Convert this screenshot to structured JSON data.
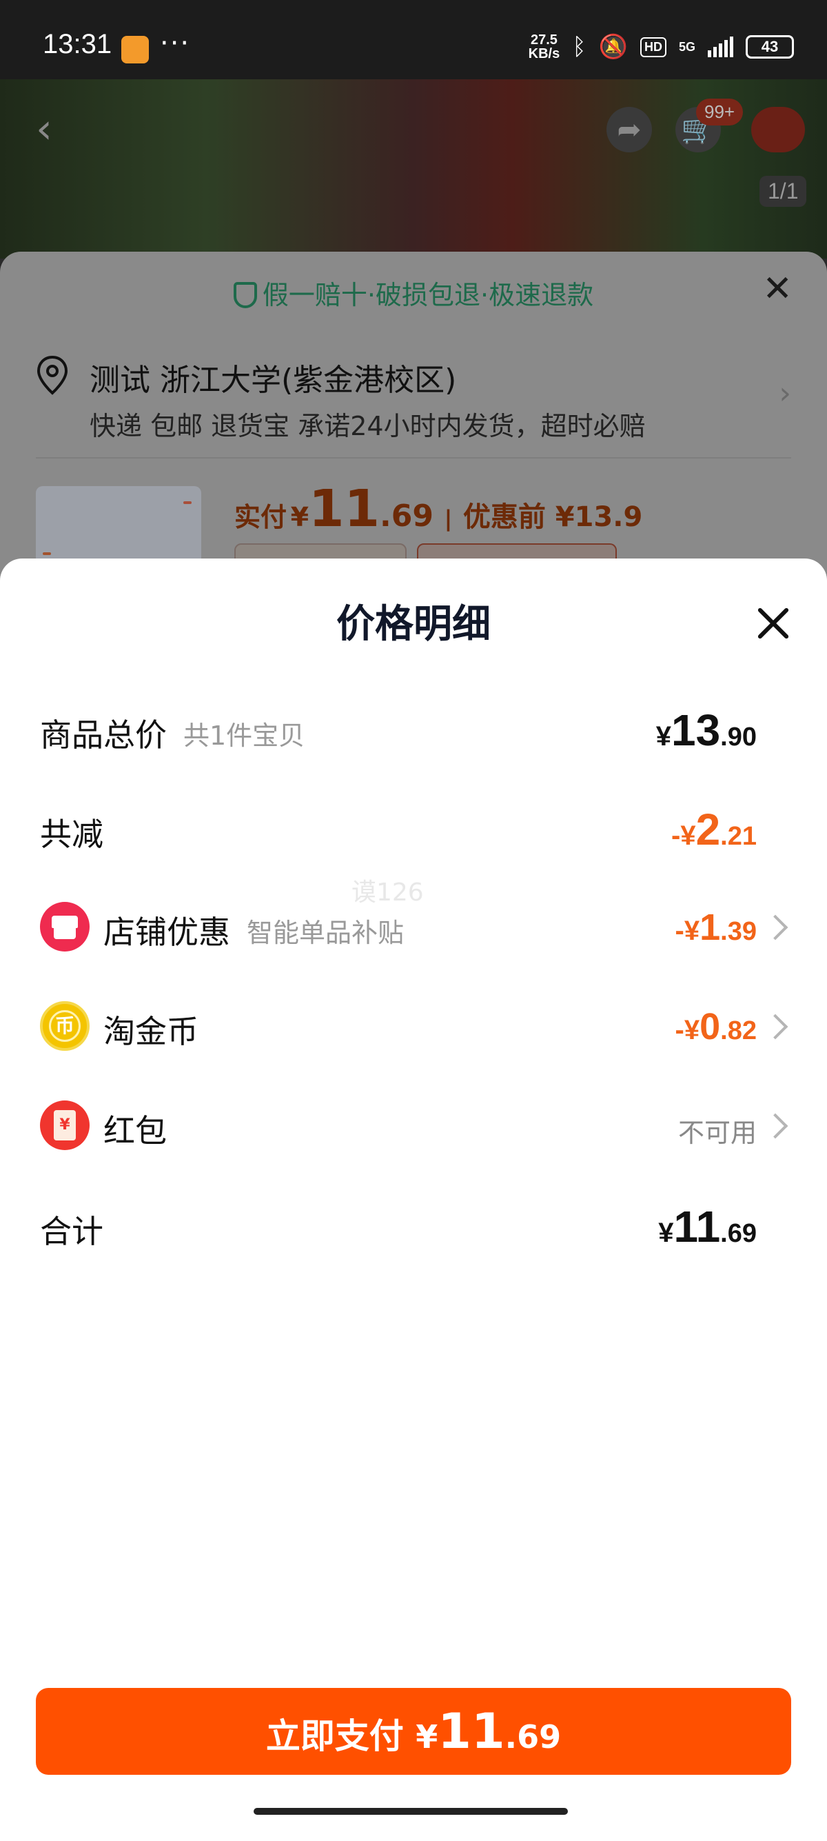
{
  "status_bar": {
    "time": "13:31",
    "more": "···",
    "net_speed_value": "27.5",
    "net_speed_unit": "KB/s",
    "hd": "HD",
    "network": "5G",
    "battery": "43",
    "icons": [
      "app-notification-icon",
      "bluetooth-icon",
      "mute-icon",
      "signal-icon",
      "battery-icon"
    ]
  },
  "product_header": {
    "cart_badge": "99+",
    "image_counter": "1/1",
    "icons": [
      "back-icon",
      "share-icon",
      "cart-icon",
      "more-icon"
    ]
  },
  "order_sheet": {
    "guarantee": "假一赔十·破损包退·极速退款",
    "address": "测试 浙江大学(紫金港校区)",
    "shipping": "快递 包邮 退货宝 承诺24小时内发货，超时必赔",
    "pay_label": "实付",
    "pay_currency": "¥",
    "pay_int": "11",
    "pay_dec": ".69",
    "separator": "|",
    "original_label": "优惠前 ¥13.9"
  },
  "price_detail": {
    "title": "价格明细",
    "watermark": "谟126",
    "rows": [
      {
        "label": "商品总价",
        "sub": "共1件宝贝",
        "currency": "¥",
        "int": "13",
        "dec": ".90"
      },
      {
        "label": "共减",
        "currency": "-¥",
        "int": "2",
        "dec": ".21"
      },
      {
        "label": "店铺优惠",
        "sub": "智能单品补贴",
        "currency": "-¥",
        "int": "1",
        "dec": ".39",
        "icon": "shop-icon"
      },
      {
        "label": "淘金币",
        "currency": "-¥",
        "int": "0",
        "dec": ".82",
        "icon": "coin-icon",
        "icon_glyph": "币"
      },
      {
        "label": "红包",
        "value": "不可用",
        "icon": "red-envelope-icon",
        "icon_glyph": "¥"
      },
      {
        "label": "合计",
        "currency": "¥",
        "int": "11",
        "dec": ".69"
      }
    ]
  },
  "pay_button": {
    "label": "立即支付",
    "currency": "¥",
    "int": "11",
    "dec": ".69"
  },
  "colors": {
    "accent": "#ff5000",
    "discount": "#f26419",
    "guarantee": "#1e6a4b"
  }
}
